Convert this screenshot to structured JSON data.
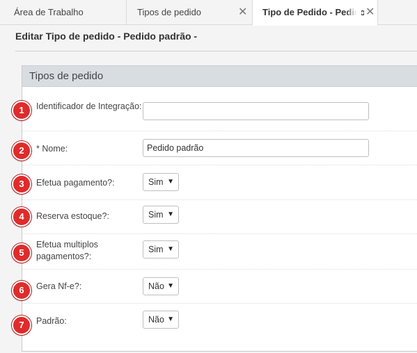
{
  "tabs": [
    {
      "label": "Área de Trabalho",
      "closable": false
    },
    {
      "label": "Tipos de pedido",
      "closable": true
    },
    {
      "label": "Tipo de Pedido - Pedido p",
      "closable": true,
      "active": true
    }
  ],
  "page": {
    "title": "Editar Tipo de pedido - Pedido padrão -"
  },
  "panel": {
    "title": "Tipos de pedido"
  },
  "fields": [
    {
      "num": "1",
      "label": "Identificador de Integração:",
      "type": "text",
      "value": ""
    },
    {
      "num": "2",
      "label": "* Nome:",
      "type": "text",
      "value": "Pedido padrão"
    },
    {
      "num": "3",
      "label": "Efetua pagamento?:",
      "type": "select",
      "value": "Sim"
    },
    {
      "num": "4",
      "label": "Reserva estoque?:",
      "type": "select",
      "value": "Sim"
    },
    {
      "num": "5",
      "label": "Efetua multiplos pagamentos?:",
      "type": "select",
      "value": "Sim"
    },
    {
      "num": "6",
      "label": "Gera Nf-e?:",
      "type": "select",
      "value": "Não"
    },
    {
      "num": "7",
      "label": "Padrão:",
      "type": "select",
      "value": "Não"
    }
  ],
  "icons": {
    "close": "close-icon",
    "dropdown": "caret-down-icon"
  },
  "colors": {
    "badge": "#e02b2b",
    "panel_header": "#d8dde2"
  }
}
